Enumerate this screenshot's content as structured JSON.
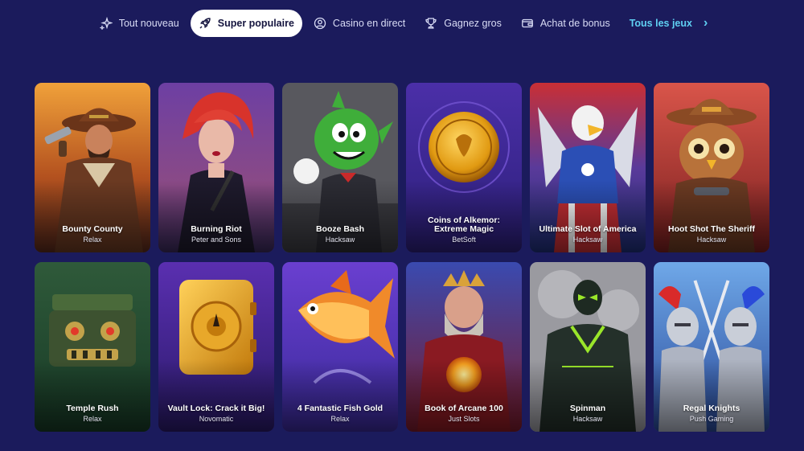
{
  "nav": {
    "tabs": [
      {
        "label": "Tout nouveau",
        "icon": "sparkle-icon"
      },
      {
        "label": "Super populaire",
        "icon": "rocket-icon",
        "active": true
      },
      {
        "label": "Casino en direct",
        "icon": "user-circle-icon"
      },
      {
        "label": "Gagnez gros",
        "icon": "trophy-icon"
      },
      {
        "label": "Achat de bonus",
        "icon": "wallet-icon"
      }
    ],
    "all_games_label": "Tous les jeux",
    "next_icon": "chevron-right-icon"
  },
  "colors": {
    "background": "#1b1b5c",
    "accent": "#5fd0f2",
    "active_tab_bg": "#ffffff"
  },
  "games": [
    {
      "title": "Bounty County",
      "provider": "Relax"
    },
    {
      "title": "Burning Riot",
      "provider": "Peter and Sons"
    },
    {
      "title": "Booze Bash",
      "provider": "Hacksaw"
    },
    {
      "title": "Coins of Alkemor: Extreme Magic",
      "provider": "BetSoft"
    },
    {
      "title": "Ultimate Slot of America",
      "provider": "Hacksaw"
    },
    {
      "title": "Hoot Shot The Sheriff",
      "provider": "Hacksaw"
    },
    {
      "title": "Temple Rush",
      "provider": "Relax"
    },
    {
      "title": "Vault Lock: Crack it Big!",
      "provider": "Novomatic"
    },
    {
      "title": "4 Fantastic Fish Gold",
      "provider": "Relax"
    },
    {
      "title": "Book of Arcane 100",
      "provider": "Just Slots"
    },
    {
      "title": "Spinman",
      "provider": "Hacksaw"
    },
    {
      "title": "Regal Knights",
      "provider": "Push Gaming"
    }
  ]
}
